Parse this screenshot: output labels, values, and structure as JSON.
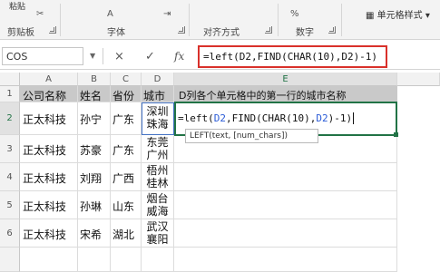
{
  "ribbon": {
    "paste_label": "粘贴",
    "clipboard_label": "剪贴板",
    "font_label": "字体",
    "alignment_label": "对齐方式",
    "number_label": "数字",
    "cell_style_label": "单元格样式"
  },
  "formula_bar": {
    "name_box": "COS",
    "cancel_icon": "×",
    "enter_icon": "✓",
    "fx_label": "fx",
    "formula": "=left(D2,FIND(CHAR(10),D2)-1)"
  },
  "columns": [
    "A",
    "B",
    "C",
    "D",
    "E"
  ],
  "rows": [
    "1",
    "2",
    "3",
    "4",
    "5",
    "6"
  ],
  "headers": {
    "A": "公司名称",
    "B": "姓名",
    "C": "省份",
    "D": "城市",
    "E": "D列各个单元格中的第一行的城市名称"
  },
  "data_rows": [
    {
      "company": "正太科技",
      "name": "孙宁",
      "province": "广东",
      "city": "深圳\n珠海"
    },
    {
      "company": "正太科技",
      "name": "苏豪",
      "province": "广东",
      "city": "东莞\n广州"
    },
    {
      "company": "正太科技",
      "name": "刘翔",
      "province": "广西",
      "city": "梧州\n桂林"
    },
    {
      "company": "正太科技",
      "name": "孙琳",
      "province": "山东",
      "city": "烟台\n威海"
    },
    {
      "company": "正太科技",
      "name": "宋希",
      "province": "湖北",
      "city": "武汉\n襄阳"
    }
  ],
  "edit_cell": {
    "prefix": "=left(",
    "ref1": "D2",
    "middle": ",FIND(CHAR(10),",
    "ref2": "D2",
    "suffix": ")-1)"
  },
  "tooltip": "LEFT(text, [num_chars])",
  "colors": {
    "excel_green": "#217346",
    "formula_highlight": "#d9312b",
    "ref_blue": "#2a5bd7"
  }
}
